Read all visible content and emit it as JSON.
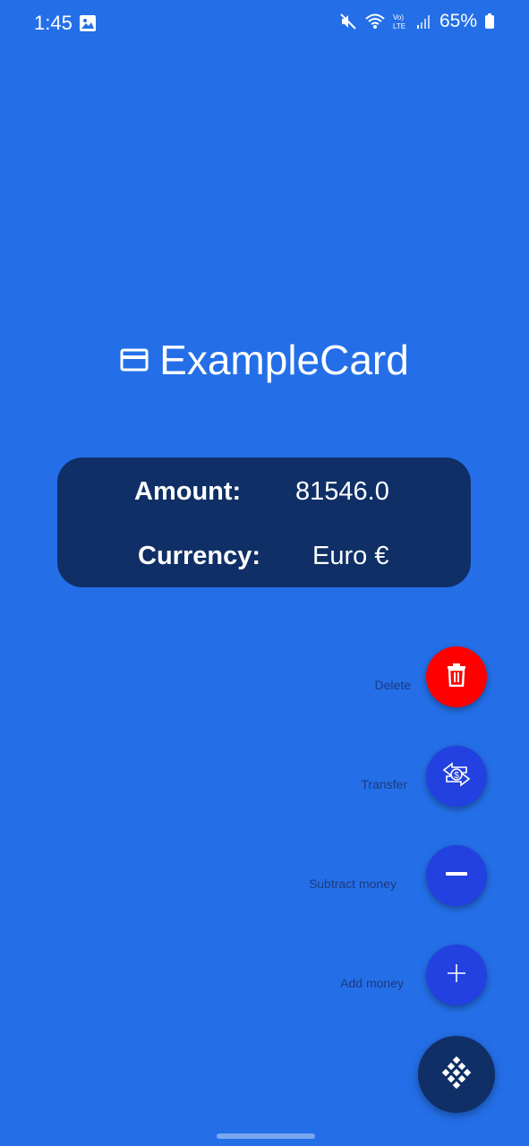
{
  "status_bar": {
    "time": "1:45",
    "battery_percent": "65%",
    "icons": [
      "gallery-icon",
      "mute-icon",
      "wifi-icon",
      "volte-icon",
      "signal-icon",
      "battery-icon"
    ]
  },
  "card": {
    "name": "ExampleCard",
    "icon": "credit-card-icon",
    "amount_label": "Amount:",
    "amount_value": "81546.0",
    "currency_label": "Currency:",
    "currency_value": "Euro €"
  },
  "actions": {
    "delete_label": "Delete",
    "transfer_label": "Transfer",
    "subtract_label": "Subtract money",
    "add_label": "Add money"
  },
  "colors": {
    "background": "#246FE8",
    "card": "#0F2F66",
    "delete": "#FF0000",
    "action": "#2340E0",
    "main_fab": "#0F2F66"
  }
}
